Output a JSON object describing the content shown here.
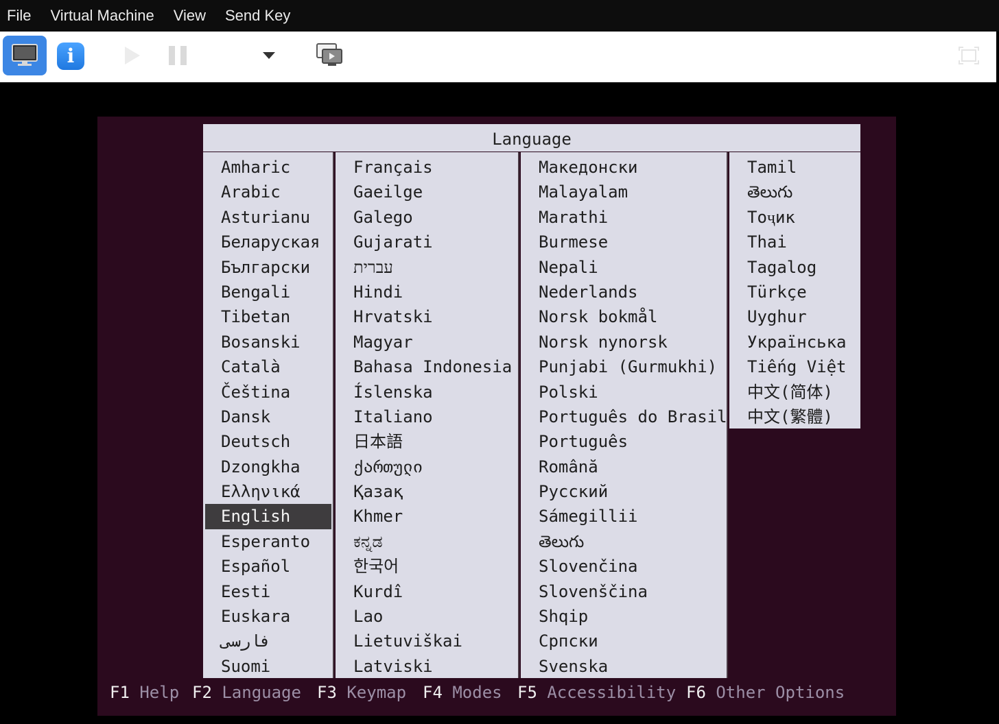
{
  "menubar": {
    "items": [
      "File",
      "Virtual Machine",
      "View",
      "Send Key"
    ]
  },
  "toolbar": {
    "buttons": [
      {
        "name": "console-monitor-icon",
        "active": true
      },
      {
        "name": "info-icon",
        "label": "i"
      },
      {
        "name": "play-icon",
        "enabled": false
      },
      {
        "name": "pause-icon",
        "enabled": false
      },
      {
        "name": "chevron-down-icon"
      },
      {
        "name": "screens-icon"
      },
      {
        "name": "fullscreen-icon",
        "enabled": false
      }
    ],
    "accent": "#3c86e4"
  },
  "installer": {
    "title": "Language",
    "selected": "English",
    "columns": [
      [
        "Amharic",
        "Arabic",
        "Asturianu",
        "Беларуская",
        "Български",
        "Bengali",
        "Tibetan",
        "Bosanski",
        "Català",
        "Čeština",
        "Dansk",
        "Deutsch",
        "Dzongkha",
        "Ελληνικά",
        "English",
        "Esperanto",
        "Español",
        "Eesti",
        "Euskara",
        "فارسی",
        "Suomi"
      ],
      [
        "Français",
        "Gaeilge",
        "Galego",
        "Gujarati",
        "עברית",
        "Hindi",
        "Hrvatski",
        "Magyar",
        "Bahasa Indonesia",
        "Íslenska",
        "Italiano",
        "日本語",
        "ქართული",
        "Қазақ",
        "Khmer",
        "ಕನ್ನಡ",
        "한국어",
        "Kurdî",
        "Lao",
        "Lietuviškai",
        "Latviski"
      ],
      [
        "Македонски",
        "Malayalam",
        "Marathi",
        "Burmese",
        "Nepali",
        "Nederlands",
        "Norsk bokmål",
        "Norsk nynorsk",
        "Punjabi (Gurmukhi)",
        "Polski",
        "Português do Brasil",
        "Português",
        "Română",
        "Русский",
        "Sámegillii",
        "తెలుగు",
        "Slovenčina",
        "Slovenščina",
        "Shqip",
        "Српски",
        "Svenska"
      ],
      [
        "Tamil",
        "తెలుగు",
        "Тоҷик",
        "Thai",
        "Tagalog",
        "Türkçe",
        "Uyghur",
        "Українська",
        "Tiếng Việt",
        "中文(简体)",
        "中文(繁體)"
      ]
    ],
    "fkeys": [
      {
        "key": "F1",
        "label": "Help"
      },
      {
        "key": "F2",
        "label": "Language"
      },
      {
        "key": "F3",
        "label": "Keymap"
      },
      {
        "key": "F4",
        "label": "Modes"
      },
      {
        "key": "F5",
        "label": "Accessibility"
      },
      {
        "key": "F6",
        "label": "Other Options"
      }
    ],
    "colors": {
      "background": "#2b0a1e",
      "dialog": "#dcdce7",
      "selection": "#3e3c3e",
      "fkey_label": "#9c8fa6"
    }
  }
}
